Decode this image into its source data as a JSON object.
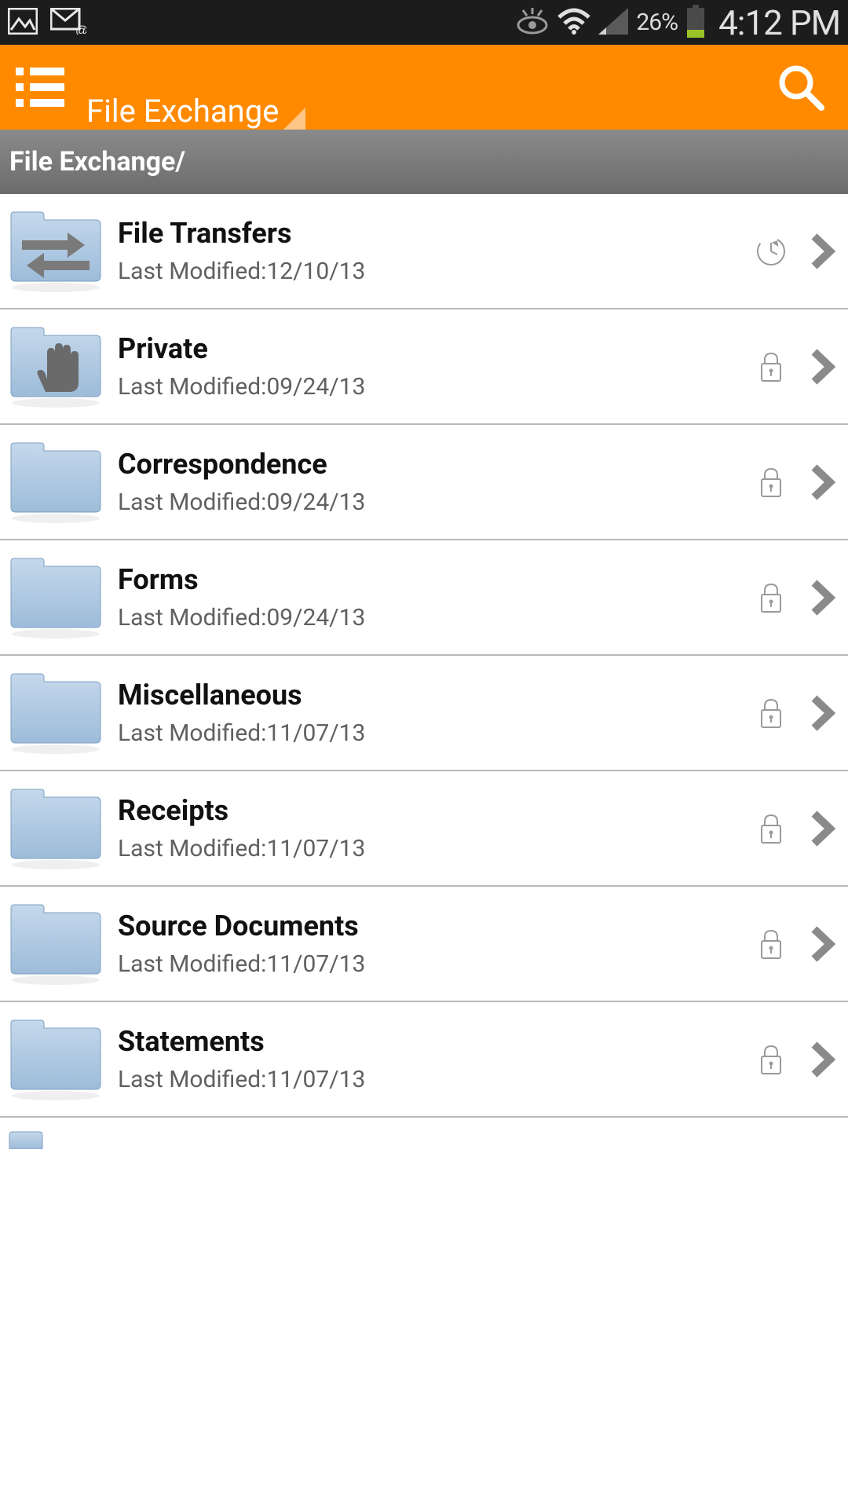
{
  "status": {
    "battery_pct": "26%",
    "time": "4:12 PM"
  },
  "appbar": {
    "title": "File Exchange"
  },
  "breadcrumb": {
    "path": "File Exchange/"
  },
  "list": {
    "modified_prefix": "Last Modified:",
    "items": [
      {
        "title": "File Transfers",
        "modified": "12/10/13",
        "icon": "transfer",
        "indicator": "clock"
      },
      {
        "title": "Private",
        "modified": "09/24/13",
        "icon": "hand",
        "indicator": "lock"
      },
      {
        "title": "Correspondence",
        "modified": "09/24/13",
        "icon": "plain",
        "indicator": "lock"
      },
      {
        "title": "Forms",
        "modified": "09/24/13",
        "icon": "plain",
        "indicator": "lock"
      },
      {
        "title": "Miscellaneous",
        "modified": "11/07/13",
        "icon": "plain",
        "indicator": "lock"
      },
      {
        "title": "Receipts",
        "modified": "11/07/13",
        "icon": "plain",
        "indicator": "lock"
      },
      {
        "title": "Source Documents",
        "modified": "11/07/13",
        "icon": "plain",
        "indicator": "lock"
      },
      {
        "title": "Statements",
        "modified": "11/07/13",
        "icon": "plain",
        "indicator": "lock"
      }
    ]
  }
}
